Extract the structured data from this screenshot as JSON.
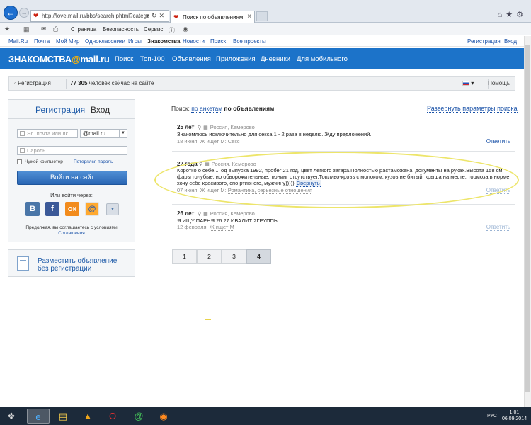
{
  "browser": {
    "url": "http://love.mail.ru/bbs/search.phtml?categoryId",
    "tab_title": "Поиск по объявлениям",
    "command_bar": [
      "Страница",
      "Безопасность",
      "Сервис"
    ]
  },
  "portal_links": [
    "Mail.Ru",
    "Почта",
    "Мой Мир",
    "Одноклассники",
    "Игры",
    "Знакомства",
    "Новости",
    "Поиск",
    "Все проекты"
  ],
  "portal_right": [
    "Регистрация",
    "Вход"
  ],
  "header": {
    "logo_main": "ЗНАКОМСТВА",
    "logo_at": "@",
    "logo_tail": "mail.ru",
    "nav": [
      "Поиск",
      "Топ-100",
      "Объявления",
      "Приложения",
      "Дневники",
      "Для мобильного"
    ]
  },
  "graybar": {
    "register": "Регистрация",
    "online_count": "77 305",
    "online_text": "человек сейчас на сайте",
    "search_button": "Помощь"
  },
  "login": {
    "tab_register": "Регистрация",
    "tab_login": "Вход",
    "email_placeholder": "Эл. почта или лк",
    "domain": "@mail.ru",
    "password_placeholder": "Пароль",
    "foreign_computer": "Чужой компьютер",
    "forgot": "Потерялся пароль",
    "submit": "Войти на сайт",
    "or_via": "Или войти через:",
    "agree_text": "Предолжая, вы соглашаетесь с условиями",
    "agree_link": "Соглашения"
  },
  "post_ad": {
    "line1": "Разместить объявление",
    "line2": "без регистрации"
  },
  "search": {
    "label": "Поиск:",
    "by_profiles": "по анкетам",
    "by_ads": "по объявлениям",
    "expand": "Развернуть параметры поиска"
  },
  "ads": [
    {
      "age": "25 лет",
      "location": "Россия, Кемерово",
      "text": "Знакомлюсь исключительно для секса 1 - 2 раза в неделю. Жду предложений.",
      "date": "18 июня, Ж ищет М:",
      "interest": "Секс",
      "reply": "Ответить"
    },
    {
      "age": "22 года",
      "location": "Россия, Кемерово",
      "text": "Коротко о себе...Год выпуска 1992, пробег 21 год, цвет лёгкого загара.Полностью растаможена, документы на руках.Высота 158 см, фары голубые, но обворожительные, тюнинг отсутствует.Топливо-кровь с молоком, кузов не битый, крыша на месте, тормоза в норме. хочу себе красивого, спо ртивного, мужчину)))))",
      "collapse": "Свернуть",
      "date": "07 июня, Ж ищет М:",
      "interest": "Романтика, серьезные отношения",
      "reply": "Ответить"
    },
    {
      "age": "26 лет",
      "location": "Россия, Кемерово",
      "text": "Я ИЩУ ПАРНЯ 26 27 ИВАЛИТ 2ГРУППЫ",
      "date": "12 февраля,",
      "interest": "Ж ищет М",
      "reply": "Ответить"
    }
  ],
  "pages": [
    "1",
    "2",
    "3",
    "4"
  ],
  "current_page": "4",
  "taskbar": {
    "lang": "РУС",
    "time": "1:01",
    "date": "06.09.2014"
  },
  "colors": {
    "header_blue": "#1c73c9",
    "link_blue": "#1a52a8",
    "highlight_ellipse": "#ede56a"
  }
}
